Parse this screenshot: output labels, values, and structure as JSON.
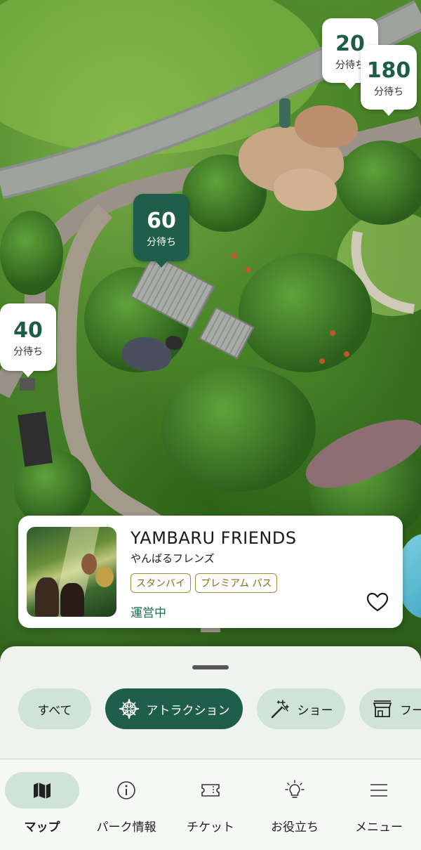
{
  "map": {
    "pins": [
      {
        "id": "pin-20",
        "value": "20",
        "label": "分待ち",
        "active": false
      },
      {
        "id": "pin-180",
        "value": "180",
        "label": "分待ち",
        "active": false
      },
      {
        "id": "pin-60",
        "value": "60",
        "label": "分待ち",
        "active": true
      },
      {
        "id": "pin-40",
        "value": "40",
        "label": "分待ち",
        "active": false
      }
    ]
  },
  "card": {
    "title": "YAMBARU FRIENDS",
    "subtitle": "やんばるフレンズ",
    "tags": [
      "スタンバイ",
      "プレミアム パス"
    ],
    "status": "運営中",
    "favorite_icon": "heart-outline-icon"
  },
  "filters": [
    {
      "label": "すべて",
      "icon": "",
      "active": false
    },
    {
      "label": "アトラクション",
      "icon": "compass-star-icon",
      "active": true
    },
    {
      "label": "ショー",
      "icon": "sparkle-wand-icon",
      "active": false
    },
    {
      "label": "フー",
      "icon": "storefront-icon",
      "active": false
    }
  ],
  "tabs": [
    {
      "label": "マップ",
      "icon": "map-icon",
      "active": true
    },
    {
      "label": "パーク情報",
      "icon": "info-icon",
      "active": false
    },
    {
      "label": "チケット",
      "icon": "ticket-icon",
      "active": false
    },
    {
      "label": "お役立ち",
      "icon": "lightbulb-icon",
      "active": false
    },
    {
      "label": "メニュー",
      "icon": "menu-icon",
      "active": false
    }
  ],
  "colors": {
    "primary": "#1e5e4a",
    "chip": "#cfe3d8",
    "tag": "#8a6d18"
  }
}
